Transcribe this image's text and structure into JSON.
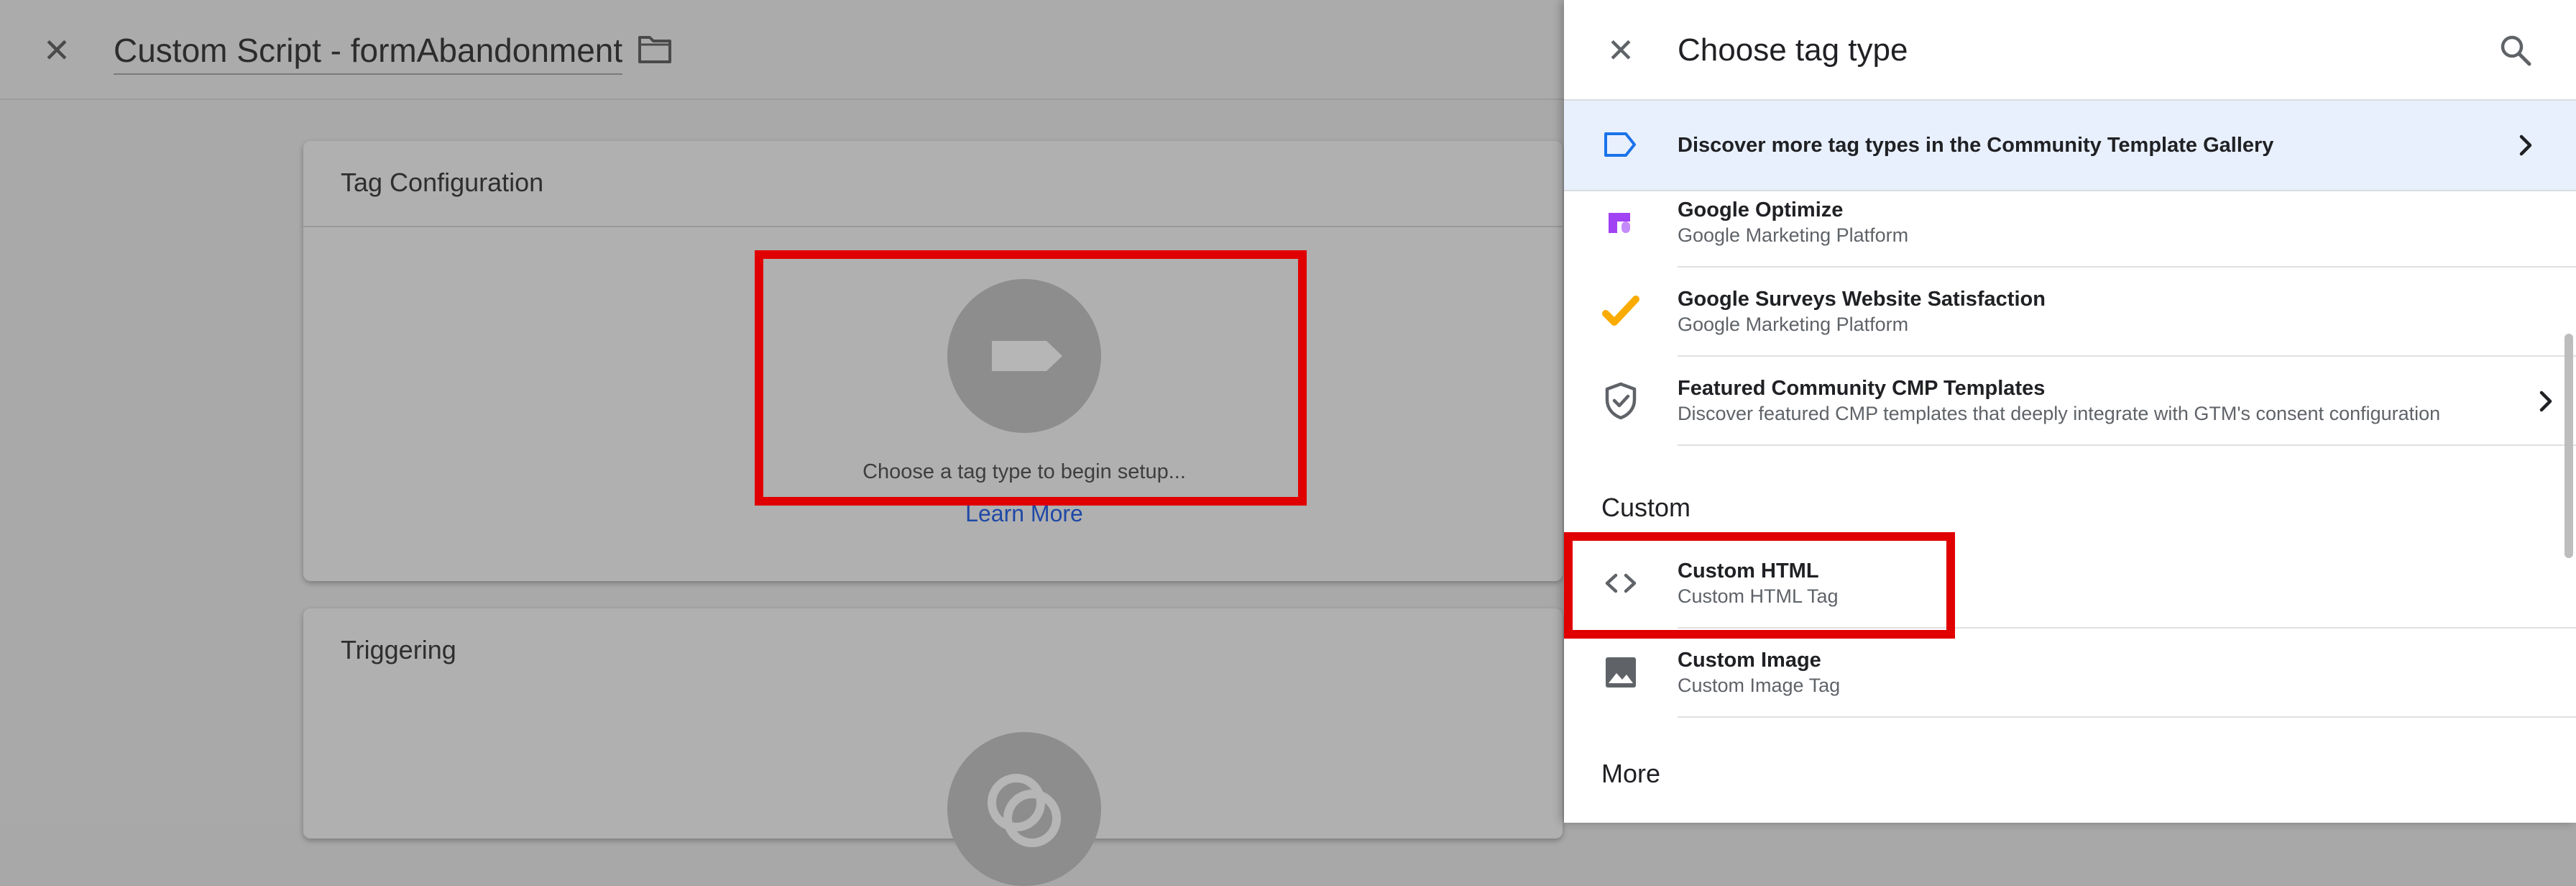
{
  "editor": {
    "title": "Custom Script - formAbandonment",
    "close_icon": "close-icon",
    "folder_icon": "folder-icon",
    "tag_config": {
      "title": "Tag Configuration",
      "placeholder_text": "Choose a tag type to begin setup...",
      "learn_more": "Learn More"
    },
    "triggering": {
      "title": "Triggering"
    }
  },
  "panel": {
    "title": "Choose tag type",
    "banner_text": "Discover more tag types in the Community Template Gallery",
    "items": [
      {
        "title": "Google Optimize",
        "subtitle": "Google Marketing Platform",
        "icon": "google-optimize-icon"
      },
      {
        "title": "Google Surveys Website Satisfaction",
        "subtitle": "Google Marketing Platform",
        "icon": "google-surveys-icon"
      },
      {
        "title": "Featured Community CMP Templates",
        "subtitle": "Discover featured CMP templates that deeply integrate with GTM's consent configuration",
        "icon": "shield-check-icon"
      }
    ],
    "custom_section": "Custom",
    "custom_items": [
      {
        "title": "Custom HTML",
        "subtitle": "Custom HTML Tag",
        "icon": "code-icon"
      },
      {
        "title": "Custom Image",
        "subtitle": "Custom Image Tag",
        "icon": "image-icon"
      }
    ],
    "more_section": "More"
  },
  "colors": {
    "highlight": "#e00000",
    "banner_bg": "#e8f0fe",
    "link": "#1f49a6"
  }
}
